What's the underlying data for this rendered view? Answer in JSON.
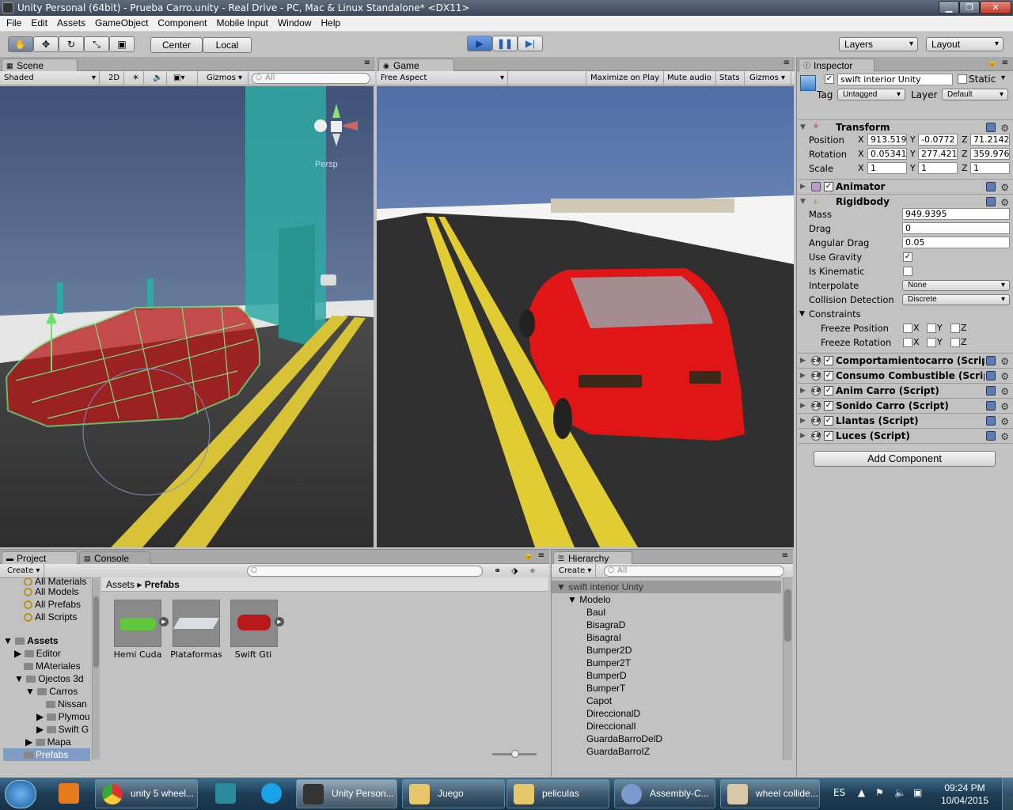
{
  "window": {
    "title": "Unity Personal (64bit) - Prueba Carro.unity - Real Drive - PC, Mac & Linux Standalone* <DX11>"
  },
  "menu": [
    "File",
    "Edit",
    "Assets",
    "GameObject",
    "Component",
    "Mobile Input",
    "Window",
    "Help"
  ],
  "toolbar": {
    "center_label": "Center",
    "local_label": "Local",
    "layers_label": "Layers",
    "layout_label": "Layout"
  },
  "scene": {
    "tab": "Scene",
    "shading": "Shaded",
    "mode2d": "2D",
    "gizmos": "Gizmos",
    "search_placeholder": "All",
    "persp": "Persp"
  },
  "game": {
    "tab": "Game",
    "aspect": "Free Aspect",
    "maximize": "Maximize on Play",
    "mute": "Mute audio",
    "stats": "Stats",
    "gizmos": "Gizmos"
  },
  "inspector": {
    "tab": "Inspector",
    "object_name": "swift interior Unity",
    "static_label": "Static",
    "tag_label": "Tag",
    "tag_value": "Untagged",
    "layer_label": "Layer",
    "layer_value": "Default",
    "transform": {
      "title": "Transform",
      "position_label": "Position",
      "position": {
        "x": "913.519",
        "y": "-0.0772",
        "z": "71.2142"
      },
      "rotation_label": "Rotation",
      "rotation": {
        "x": "0.05341",
        "y": "277.421",
        "z": "359.976"
      },
      "scale_label": "Scale",
      "scale": {
        "x": "1",
        "y": "1",
        "z": "1"
      }
    },
    "animator_title": "Animator",
    "rigidbody": {
      "title": "Rigidbody",
      "mass_label": "Mass",
      "mass": "949.9395",
      "drag_label": "Drag",
      "drag": "0",
      "angular_drag_label": "Angular Drag",
      "angular_drag": "0.05",
      "use_gravity_label": "Use Gravity",
      "use_gravity": true,
      "is_kinematic_label": "Is Kinematic",
      "is_kinematic": false,
      "interpolate_label": "Interpolate",
      "interpolate": "None",
      "collision_label": "Collision Detection",
      "collision": "Discrete",
      "constraints_label": "Constraints",
      "freeze_position_label": "Freeze Position",
      "freeze_rotation_label": "Freeze Rotation",
      "axis_x": "X",
      "axis_y": "Y",
      "axis_z": "Z"
    },
    "scripts": [
      "Comportamientocarro (Script)",
      "Consumo Combustible (Script)",
      "Anim Carro (Script)",
      "Sonido Carro (Script)",
      "Llantas (Script)",
      "Luces (Script)"
    ],
    "add_component": "Add Component"
  },
  "project": {
    "tab": "Project",
    "console_tab": "Console",
    "create": "Create",
    "favorites": [
      "All Materials",
      "All Models",
      "All Prefabs",
      "All Scripts"
    ],
    "tree": {
      "assets": "Assets",
      "editor": "Editor",
      "materiales": "MAteriales",
      "objetos": "Ojectos 3d",
      "carros": "Carros",
      "nissan": "Nissan",
      "plymouth": "Plymou",
      "swift": "Swift G",
      "mapa": "Mapa",
      "prefabs": "Prefabs"
    },
    "breadcrumb": {
      "root": "Assets",
      "current": "Prefabs"
    },
    "assets": [
      {
        "name": "Hemi Cuda",
        "color": "#5fc83a"
      },
      {
        "name": "Plataformas",
        "color": "#d8dde3"
      },
      {
        "name": "Swift Gti",
        "color": "#b81818"
      }
    ]
  },
  "hierarchy": {
    "tab": "Hierarchy",
    "create": "Create",
    "search_placeholder": "All",
    "root": "swift interior Unity",
    "child": "Modelo",
    "items": [
      "Baul",
      "BisagraD",
      "BisagraI",
      "Bumper2D",
      "Bumper2T",
      "BumperD",
      "BumperT",
      "Capot",
      "DireccionalD",
      "DireccionalI",
      "GuardaBarroDelD",
      "GuardaBarroIZ"
    ]
  },
  "taskbar": {
    "items": [
      "unity 5 wheel...",
      "Unity Person...",
      "Juego",
      "peliculas",
      "Assembly-C...",
      "wheel collide..."
    ],
    "lang": "ES",
    "time": "09:24 PM",
    "date": "10/04/2015"
  },
  "colors": {
    "accent": "#3a6fc2",
    "car_red": "#e01515",
    "wireframe": "#7be07b",
    "road_yellow": "#e8d23a"
  }
}
